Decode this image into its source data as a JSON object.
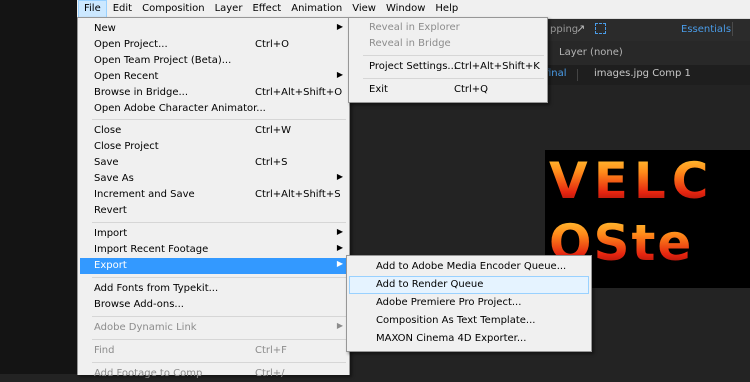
{
  "menubar": {
    "items": [
      "File",
      "Edit",
      "Composition",
      "Layer",
      "Effect",
      "Animation",
      "View",
      "Window",
      "Help"
    ]
  },
  "background": {
    "snap_label": "pping",
    "snap_icon": "snapping-arrow-icon",
    "workspace": "Essentials",
    "layer_label": "Layer (none)",
    "comp_tab_active": "final",
    "comp_tab_next": "images.jpg Comp 1",
    "comp_text_line1": "VELC",
    "comp_text_line2": "OSte"
  },
  "file_menu": {
    "new": {
      "label": "New"
    },
    "open_project": {
      "label": "Open Project...",
      "shortcut": "Ctrl+O"
    },
    "open_team_project": {
      "label": "Open Team Project (Beta)..."
    },
    "open_recent": {
      "label": "Open Recent"
    },
    "browse_in_bridge": {
      "label": "Browse in Bridge...",
      "shortcut": "Ctrl+Alt+Shift+O"
    },
    "open_character_animator": {
      "label": "Open Adobe Character Animator..."
    },
    "close": {
      "label": "Close",
      "shortcut": "Ctrl+W"
    },
    "close_project": {
      "label": "Close Project"
    },
    "save": {
      "label": "Save",
      "shortcut": "Ctrl+S"
    },
    "save_as": {
      "label": "Save As"
    },
    "increment_and_save": {
      "label": "Increment and Save",
      "shortcut": "Ctrl+Alt+Shift+S"
    },
    "revert": {
      "label": "Revert"
    },
    "import": {
      "label": "Import"
    },
    "import_recent_footage": {
      "label": "Import Recent Footage"
    },
    "export": {
      "label": "Export"
    },
    "add_fonts_typekit": {
      "label": "Add Fonts from Typekit..."
    },
    "browse_addons": {
      "label": "Browse Add-ons..."
    },
    "adobe_dynamic_link": {
      "label": "Adobe Dynamic Link"
    },
    "find": {
      "label": "Find",
      "shortcut": "Ctrl+F"
    },
    "add_footage_to_comp": {
      "label": "Add Footage to Comp",
      "shortcut": "Ctrl+/"
    }
  },
  "right_menu": {
    "reveal_in_explorer": {
      "label": "Reveal in Explorer"
    },
    "reveal_in_bridge": {
      "label": "Reveal in Bridge"
    },
    "project_settings": {
      "label": "Project Settings...",
      "shortcut": "Ctrl+Alt+Shift+K"
    },
    "exit": {
      "label": "Exit",
      "shortcut": "Ctrl+Q"
    }
  },
  "export_menu": {
    "items": [
      "Add to Adobe Media Encoder Queue...",
      "Add to Render Queue",
      "Adobe Premiere Pro Project...",
      "Composition As Text Template...",
      "MAXON Cinema 4D Exporter..."
    ]
  }
}
